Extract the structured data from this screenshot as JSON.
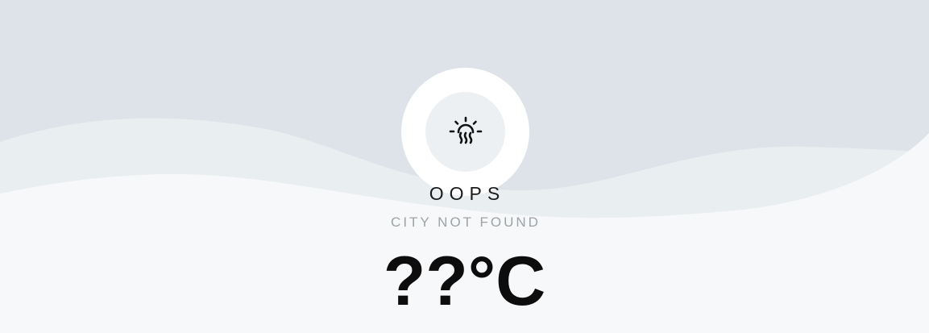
{
  "weather": {
    "icon": "sun-haze-icon",
    "title": "OOPS",
    "subtitle": "CITY NOT FOUND",
    "temperature": "??°C"
  },
  "colors": {
    "sky": "#dde3e8",
    "wave_light": "#e9eef1",
    "ground": "#f6f8f9",
    "icon_outer": "#ffffff",
    "icon_inner": "#edf0f2",
    "text_dark": "#0d0d0d",
    "text_muted": "#9ea3a7"
  }
}
